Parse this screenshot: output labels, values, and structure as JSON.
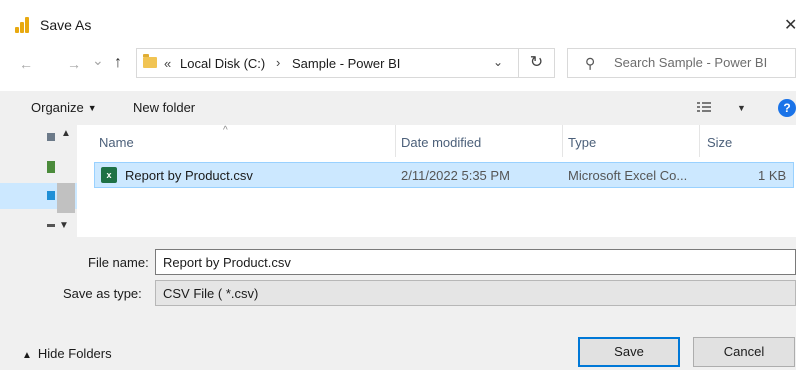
{
  "window": {
    "title": "Save As",
    "close_glyph": "✕"
  },
  "address": {
    "back_glyph": "←",
    "forward_glyph": "→",
    "recent_glyph": "⌄",
    "up_glyph": "↑",
    "overflow": "«",
    "crumbs": [
      "Local Disk (C:)",
      "Sample - Power BI"
    ],
    "separator": "›",
    "dropdown_glyph": "⌄",
    "refresh_glyph": "↻"
  },
  "search": {
    "icon": "search-icon",
    "placeholder": "Search Sample - Power BI"
  },
  "toolbar": {
    "organize_label": "Organize",
    "new_folder_label": "New folder",
    "help_label": "?"
  },
  "columns": {
    "name": "Name",
    "date": "Date modified",
    "type": "Type",
    "size": "Size"
  },
  "files": [
    {
      "icon": "excel-csv-icon",
      "name": "Report by Product.csv",
      "date": "2/11/2022 5:35 PM",
      "type": "Microsoft Excel Co...",
      "size": "1 KB",
      "selected": true
    }
  ],
  "form": {
    "file_name_label": "File name:",
    "file_name_value": "Report by Product.csv",
    "save_type_label": "Save as type:",
    "save_type_value": "CSV File  ( *.csv)"
  },
  "footer": {
    "hide_folders_label": "Hide Folders",
    "save_label": "Save",
    "cancel_label": "Cancel"
  },
  "colors": {
    "accent": "#0078d7",
    "selection": "#cce8ff",
    "selection_border": "#99d1ff",
    "panel": "#f0f0f0"
  }
}
